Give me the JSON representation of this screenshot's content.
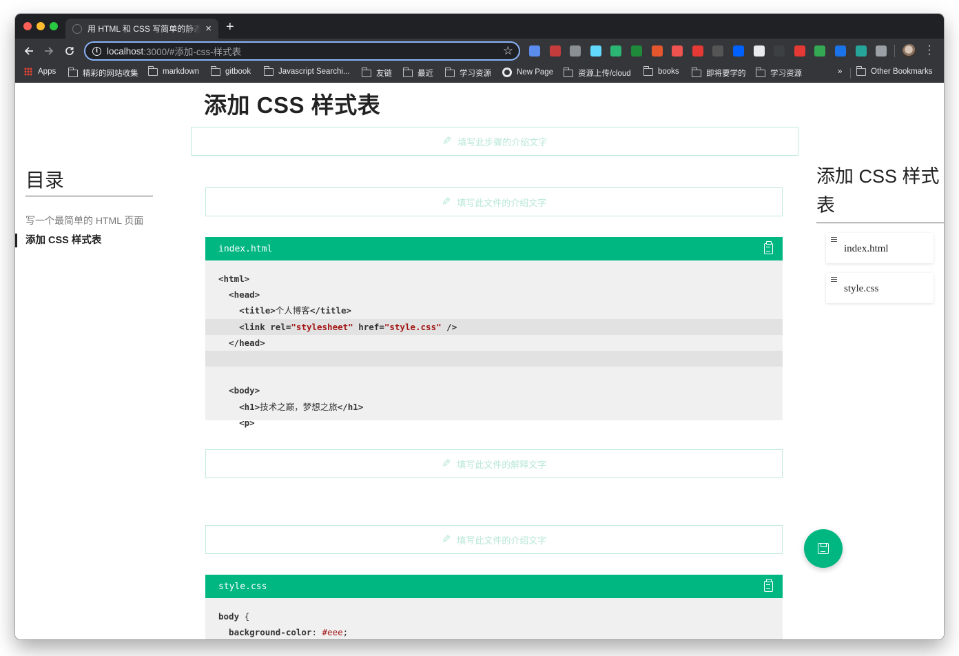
{
  "browser": {
    "tab_title": "用 HTML 和 CSS 写简单的静态页面",
    "tab_close": "×",
    "new_tab": "+",
    "url_host": "localhost",
    "url_rest": ":3000/#添加-css-样式表",
    "info_glyph": "i",
    "star_glyph": "☆",
    "extensions": [
      {
        "icon": "shield-icon",
        "color": "#5b8def"
      },
      {
        "icon": "braces-icon",
        "color": "#c43c3c"
      },
      {
        "icon": "clipboard-icon",
        "color": "#8a8f94"
      },
      {
        "icon": "react-icon",
        "color": "#61dafb"
      },
      {
        "icon": "target-icon",
        "color": "#2bb673"
      },
      {
        "icon": "terminal-icon",
        "color": "#1f8a3a"
      },
      {
        "icon": "fox-icon",
        "color": "#e4572e"
      },
      {
        "icon": "arrow-icon",
        "color": "#ef5350"
      },
      {
        "icon": "translate-icon",
        "color": "#e53935"
      },
      {
        "icon": "wci-icon",
        "color": "#555555"
      },
      {
        "icon": "dropbox-icon",
        "color": "#0061ff"
      },
      {
        "icon": "document-icon",
        "color": "#e8eaed"
      },
      {
        "icon": "circle-icon",
        "color": "#3c4043"
      },
      {
        "icon": "grid-icon",
        "color": "#e53935"
      },
      {
        "icon": "gauge-icon",
        "color": "#34a853"
      },
      {
        "icon": "p-icon",
        "color": "#1a73e8"
      },
      {
        "icon": "globe-icon",
        "color": "#26a69a"
      },
      {
        "icon": "vue-icon",
        "color": "#9aa0a6"
      }
    ]
  },
  "bookmarks": [
    {
      "label": "Apps",
      "icon": "apps-icon"
    },
    {
      "label": "精彩的网站收集",
      "icon": "folder-icon"
    },
    {
      "label": "markdown",
      "icon": "folder-icon"
    },
    {
      "label": "gitbook",
      "icon": "folder-icon"
    },
    {
      "label": "Javascript Searchi...",
      "icon": "folder-icon"
    },
    {
      "label": "友链",
      "icon": "folder-icon"
    },
    {
      "label": "最近",
      "icon": "folder-icon"
    },
    {
      "label": "学习资源",
      "icon": "folder-icon"
    },
    {
      "label": "New Page",
      "icon": "github-icon"
    },
    {
      "label": "资源上传/cloud",
      "icon": "folder-icon"
    },
    {
      "label": "books",
      "icon": "folder-icon"
    },
    {
      "label": "即将要学的",
      "icon": "folder-icon"
    },
    {
      "label": "学习资源",
      "icon": "folder-icon"
    }
  ],
  "bookmarks_overflow": "»",
  "other_bookmarks": "Other Bookmarks",
  "page": {
    "title": "添加 CSS 样式表",
    "step_intro_placeholder": "填写此步骤的介绍文字",
    "file_intro_placeholder": "填写此文件的介绍文字",
    "file_explain_placeholder": "填写此文件的解释文字",
    "file_intro_placeholder_2": "填写此文件的介绍文字",
    "pencil_glyph": "✎"
  },
  "toc": {
    "title": "目录",
    "items": [
      "写一个最简单的 HTML 页面",
      "添加 CSS 样式表"
    ]
  },
  "outline": {
    "title": "添加 CSS 样式表",
    "files": [
      "index.html",
      "style.css"
    ]
  },
  "code_index": {
    "filename": "index.html",
    "lines": [
      {
        "parts": [
          {
            "t": "<html>",
            "c": "tag"
          }
        ]
      },
      {
        "parts": [
          {
            "t": "  <head>",
            "c": "tag"
          }
        ]
      },
      {
        "parts": [
          {
            "t": "    <title>",
            "c": "tag"
          },
          {
            "t": "个人博客",
            "c": ""
          },
          {
            "t": "</title>",
            "c": "tag"
          }
        ]
      },
      {
        "hl": true,
        "parts": [
          {
            "t": "    <link ",
            "c": "tag"
          },
          {
            "t": "rel=",
            "c": "attr"
          },
          {
            "t": "\"stylesheet\"",
            "c": "str"
          },
          {
            "t": " href=",
            "c": "attr"
          },
          {
            "t": "\"style.css\"",
            "c": "str"
          },
          {
            "t": " />",
            "c": "tag"
          }
        ]
      },
      {
        "parts": [
          {
            "t": "  </head>",
            "c": "tag"
          }
        ]
      },
      {
        "hl": true,
        "parts": [
          {
            "t": "",
            "c": ""
          }
        ]
      },
      {
        "parts": [
          {
            "t": "",
            "c": ""
          }
        ]
      },
      {
        "parts": [
          {
            "t": "  <body>",
            "c": "tag"
          }
        ]
      },
      {
        "parts": [
          {
            "t": "    <h1>",
            "c": "tag"
          },
          {
            "t": "技术之巅，梦想之旅",
            "c": ""
          },
          {
            "t": "</h1>",
            "c": "tag"
          }
        ]
      },
      {
        "parts": [
          {
            "t": "    <p>",
            "c": "tag"
          }
        ]
      }
    ]
  },
  "code_style": {
    "filename": "style.css",
    "lines": [
      {
        "parts": [
          {
            "t": "body ",
            "c": "tag"
          },
          {
            "t": "{",
            "c": ""
          }
        ]
      },
      {
        "parts": [
          {
            "t": "  background-color",
            "c": "attr"
          },
          {
            "t": ": ",
            "c": ""
          },
          {
            "t": "#eee",
            "c": "strlight"
          },
          {
            "t": ";",
            "c": ""
          }
        ]
      }
    ]
  },
  "colors": {
    "accent": "#00b782",
    "placeholder_border": "#bfeadd"
  }
}
